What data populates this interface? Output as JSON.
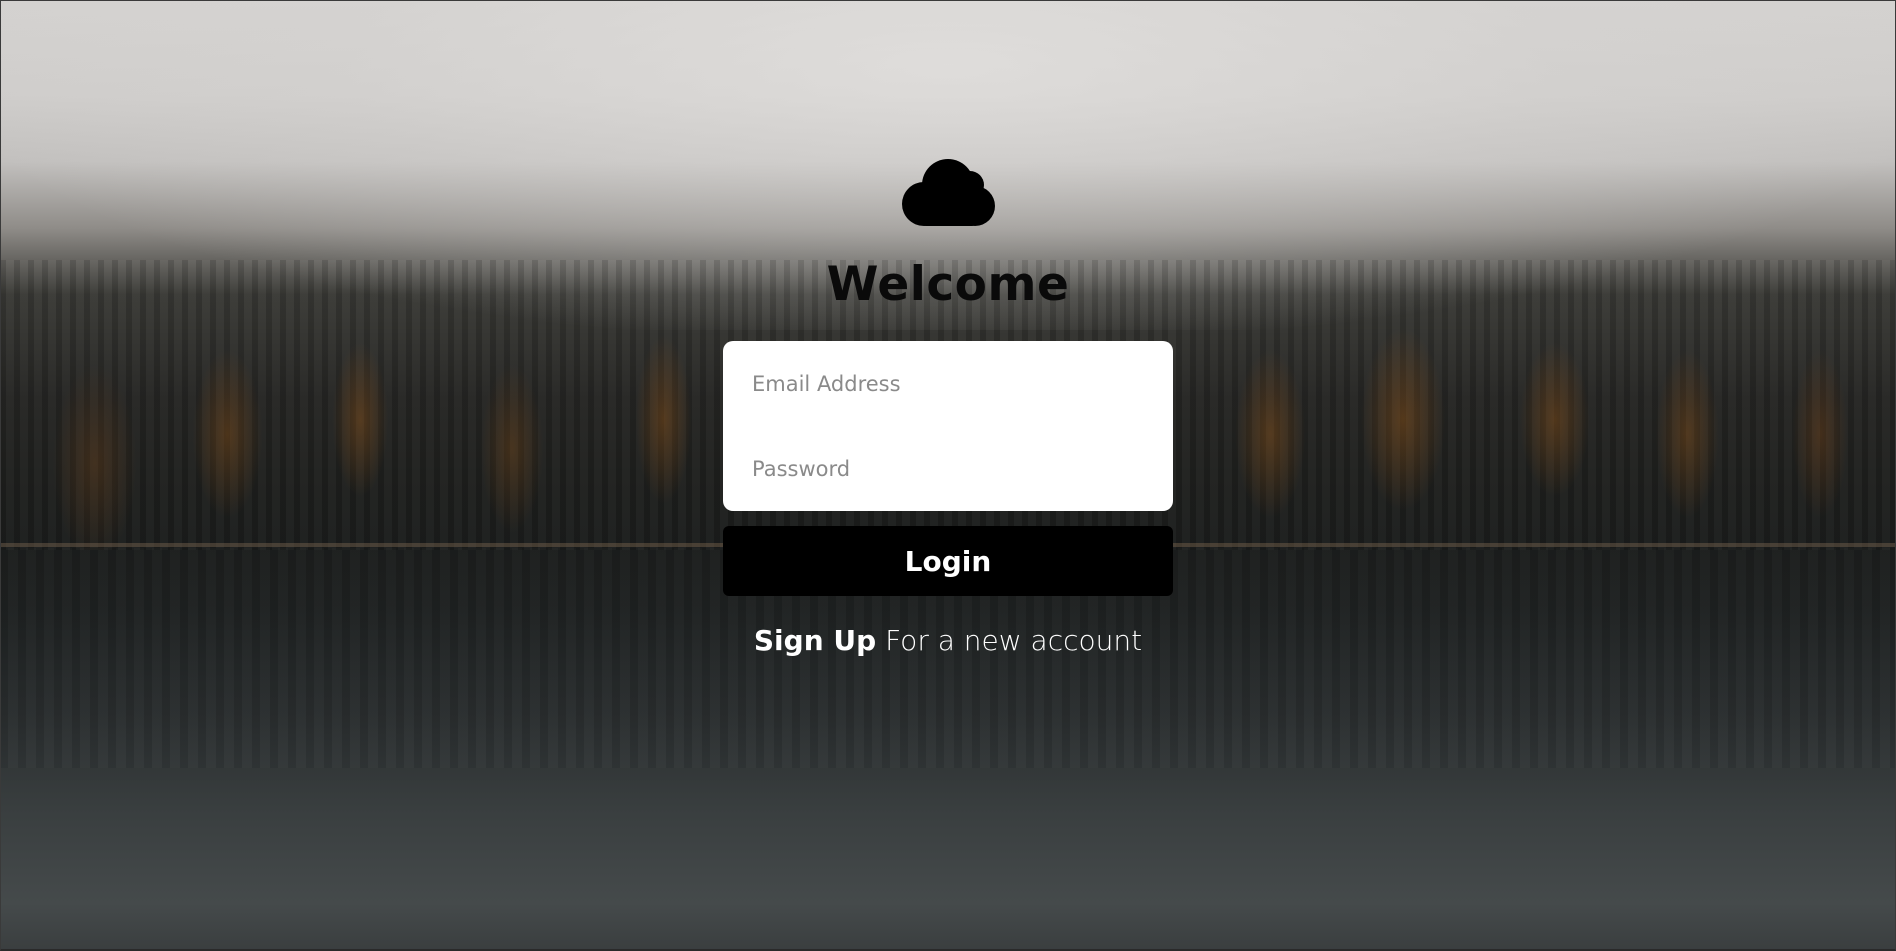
{
  "background": {
    "description_icon": "misty-forest-lake-background"
  },
  "logo": {
    "icon": "cloud-icon",
    "color": "#000000"
  },
  "heading": {
    "title": "Welcome"
  },
  "form": {
    "email_placeholder": "Email Address",
    "email_value": "",
    "password_placeholder": "Password",
    "password_value": "",
    "login_label": "Login"
  },
  "signup": {
    "link_label": "Sign Up",
    "suffix": "For a new account"
  },
  "colors": {
    "button_bg": "#000000",
    "button_text": "#ffffff",
    "form_bg": "#ffffff",
    "heading": "#0a0a0a"
  }
}
